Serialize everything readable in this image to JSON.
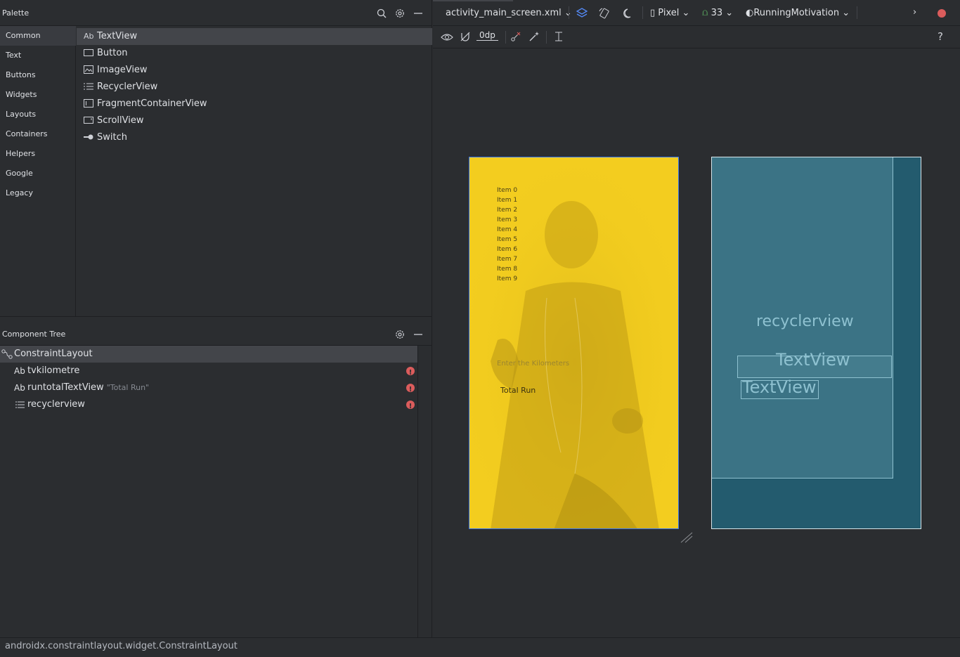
{
  "palette": {
    "title": "Palette",
    "categories": [
      {
        "label": "Common",
        "selected": true
      },
      {
        "label": "Text",
        "selected": false
      },
      {
        "label": "Buttons",
        "selected": false
      },
      {
        "label": "Widgets",
        "selected": false
      },
      {
        "label": "Layouts",
        "selected": false
      },
      {
        "label": "Containers",
        "selected": false
      },
      {
        "label": "Helpers",
        "selected": false
      },
      {
        "label": "Google",
        "selected": false
      },
      {
        "label": "Legacy",
        "selected": false
      }
    ],
    "widgets": [
      {
        "icon": "textview-icon",
        "icon_text": "Ab",
        "label": "TextView",
        "selected": true
      },
      {
        "icon": "button-icon",
        "icon_text": "",
        "label": "Button",
        "selected": false
      },
      {
        "icon": "imageview-icon",
        "icon_text": "",
        "label": "ImageView",
        "selected": false
      },
      {
        "icon": "list-icon",
        "icon_text": "",
        "label": "RecyclerView",
        "selected": false
      },
      {
        "icon": "fragment-icon",
        "icon_text": "",
        "label": "FragmentContainerView",
        "selected": false
      },
      {
        "icon": "scrollview-icon",
        "icon_text": "",
        "label": "ScrollView",
        "selected": false
      },
      {
        "icon": "switch-icon",
        "icon_text": "",
        "label": "Switch",
        "selected": false
      }
    ]
  },
  "component_tree": {
    "title": "Component Tree",
    "items": [
      {
        "icon": "constraint-layout-icon",
        "label": "ConstraintLayout",
        "hint": "",
        "error": false,
        "selected": true
      },
      {
        "icon": "textview-icon",
        "icon_text": "Ab",
        "label": "tvkilometre",
        "hint": "",
        "error": true,
        "selected": false
      },
      {
        "icon": "textview-icon",
        "icon_text": "Ab",
        "label": "runtotalTextView",
        "hint": "\"Total Run\"",
        "error": true,
        "selected": false
      },
      {
        "icon": "list-icon",
        "icon_text": "",
        "label": "recyclerview",
        "hint": "",
        "error": true,
        "selected": false
      }
    ]
  },
  "editor": {
    "file_name": "activity_main_screen.xml",
    "device": "Pixel",
    "api_level": "33",
    "theme": "RunningMotivation",
    "default_margin": "0dp"
  },
  "design_preview": {
    "list_items": [
      "Item 0",
      "Item 1",
      "Item 2",
      "Item 3",
      "Item 4",
      "Item 5",
      "Item 6",
      "Item 7",
      "Item 8",
      "Item 9"
    ],
    "edit_hint": "Enter the Kilometers",
    "total_label": "Total Run"
  },
  "blueprint": {
    "recycler_label": "recyclerview",
    "textview1_label": "TextView",
    "textview2_label": "TextView"
  },
  "status_bar": {
    "text": "androidx.constraintlayout.widget.ConstraintLayout"
  },
  "colors": {
    "design_bg": "#f3cd1f",
    "blueprint_bg": "#235b6e",
    "error": "#db5c5c",
    "selection_accent": "#3574f0"
  }
}
